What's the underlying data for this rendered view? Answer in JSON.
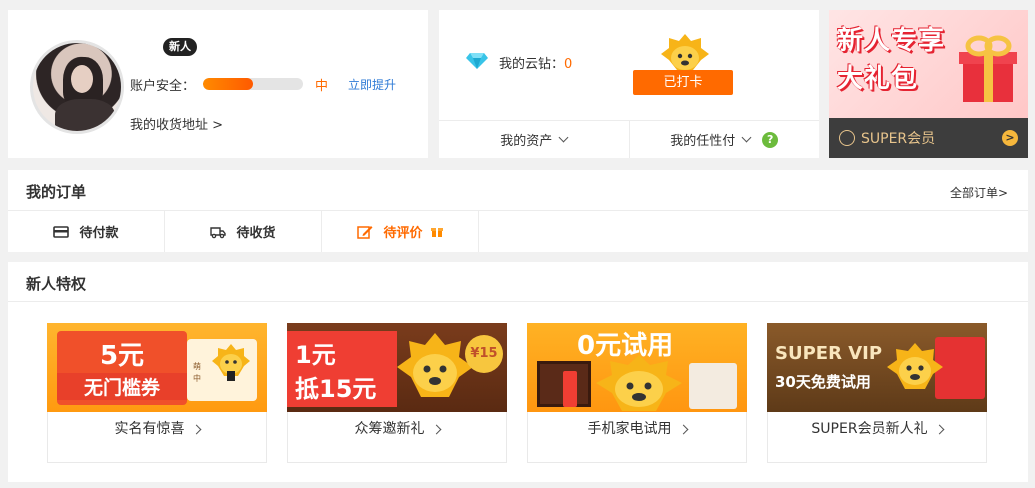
{
  "user": {
    "badge": "新人",
    "security_label": "账户安全：",
    "security_progress": 0.5,
    "security_level": "中",
    "upgrade_label": "立即提升",
    "address_label": "我的收货地址 >"
  },
  "assets": {
    "yunzuan_label": "我的云钻：",
    "yunzuan_value": "0",
    "checkin_label": "已打卡",
    "my_assets": "我的资产",
    "renxingfu": "我的任性付",
    "help_icon": "?"
  },
  "promo": {
    "line1": "新人专享",
    "line2": "大礼包",
    "bar_label": "SUPER会员",
    "go_icon": ">"
  },
  "orders": {
    "title": "我的订单",
    "all_label": "全部订单>",
    "tabs": [
      {
        "label": "待付款",
        "icon": "card-icon"
      },
      {
        "label": "待收货",
        "icon": "truck-icon"
      },
      {
        "label": "待评价",
        "icon": "edit-icon"
      }
    ]
  },
  "perks": {
    "title": "新人特权",
    "items": [
      {
        "caption": "实名有惊喜",
        "art_line1": "5元",
        "art_line2": "无门槛券",
        "art_side": "萌中"
      },
      {
        "caption": "众筹邀新礼",
        "art_line1": "1元",
        "art_line2": "抵15元",
        "art_badge": "¥15"
      },
      {
        "caption": "手机家电试用",
        "art_line1": "0元试用"
      },
      {
        "caption": "SUPER会员新人礼",
        "art_line1": "SUPER VIP",
        "art_line2": "30天免费试用"
      }
    ]
  },
  "colors": {
    "accent": "#ff6a00",
    "link": "#2f7bd6",
    "promo_bar": "#3d3d3d",
    "gold": "#e7c48c"
  }
}
